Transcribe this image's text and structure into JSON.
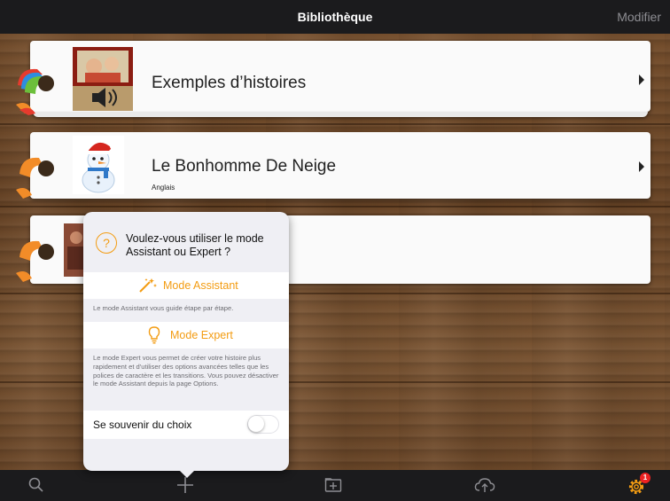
{
  "header": {
    "title": "Bibliothèque",
    "edit_label": "Modifier"
  },
  "books": [
    {
      "title": "Exemples d’histoires",
      "subtitle": ""
    },
    {
      "title": "Le Bonhomme De Neige",
      "subtitle": "Anglais"
    }
  ],
  "popover": {
    "question": "Voulez-vous utiliser le mode Assistant ou Expert ?",
    "assistant_label": "Mode Assistant",
    "assistant_desc": "Le mode Assistant vous guide étape par étape.",
    "expert_label": "Mode Expert",
    "expert_desc": "Le mode Expert vous permet de créer votre histoire plus rapidement et d'utiliser des options avancées telles que les polices de caractère et les transitions.  Vous pouvez désactiver le mode Assistant depuis la page Options.",
    "remember_label": "Se souvenir du choix",
    "remember_on": false
  },
  "toolbar": {
    "icons": [
      "search-icon",
      "add-icon",
      "add-folder-icon",
      "cloud-upload-icon",
      "gear-icon"
    ],
    "settings_badge": "1"
  },
  "colors": {
    "accent": "#f39c12",
    "bar": "#1b1b1d",
    "badge": "#e22222"
  }
}
